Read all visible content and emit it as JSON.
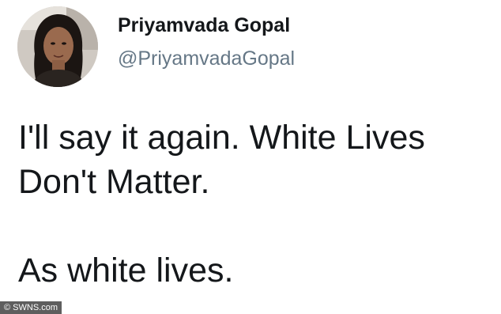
{
  "author": {
    "display_name": "Priyamvada Gopal",
    "handle": "@PriyamvadaGopal",
    "avatar_icon": "profile-photo-avatar"
  },
  "tweet": {
    "line_1": "I'll say it again. White Lives",
    "line_2": "Don't Matter.",
    "line_3": "As white lives."
  },
  "watermark": {
    "text": "© SWNS.com"
  },
  "colors": {
    "text": "#14171a",
    "handle": "#657786",
    "background": "#ffffff"
  }
}
